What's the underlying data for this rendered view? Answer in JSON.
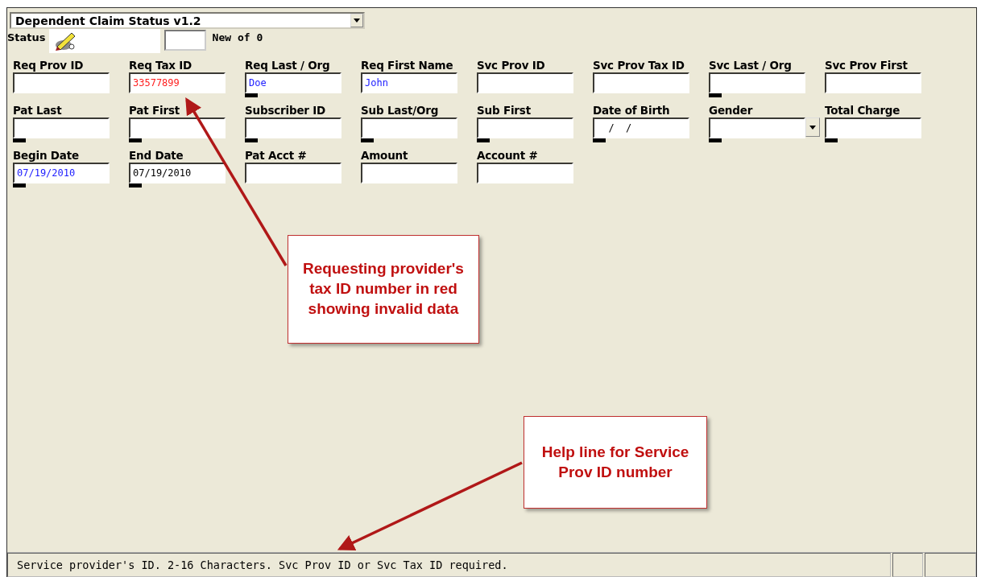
{
  "form_selector": {
    "value": "Dependent Claim Status v1.2"
  },
  "status": {
    "label": "Status",
    "new_label": "New",
    "of_label": "of 0"
  },
  "fields": [
    {
      "label": "Req Prov ID",
      "kind": "text",
      "marker": false
    },
    {
      "label": "Req Tax ID",
      "kind": "text",
      "value": "33577899",
      "color": "#ff2020",
      "marker": false
    },
    {
      "label": "Req Last / Org",
      "kind": "text",
      "value": "Doe",
      "color": "#2020ff",
      "marker": true
    },
    {
      "label": "Req First Name",
      "kind": "text",
      "value": "John",
      "color": "#2020ff",
      "marker": false
    },
    {
      "label": "Svc Prov ID",
      "kind": "text",
      "marker": false
    },
    {
      "label": "Svc Prov Tax ID",
      "kind": "text",
      "marker": false
    },
    {
      "label": "Svc Last / Org",
      "kind": "text",
      "marker": true
    },
    {
      "label": "Svc Prov First",
      "kind": "text",
      "marker": false
    },
    {
      "label": "Pat Last",
      "kind": "text",
      "marker": true
    },
    {
      "label": "Pat First",
      "kind": "text",
      "marker": true
    },
    {
      "label": "Subscriber ID",
      "kind": "text",
      "marker": true
    },
    {
      "label": "Sub Last/Org",
      "kind": "text",
      "marker": true
    },
    {
      "label": "Sub First",
      "kind": "text",
      "marker": true
    },
    {
      "label": "Date of Birth",
      "kind": "date",
      "value": "  /  /",
      "marker": true
    },
    {
      "label": "Gender",
      "kind": "dropdown",
      "marker": true
    },
    {
      "label": "Total Charge",
      "kind": "text",
      "marker": true
    },
    {
      "label": "Begin Date",
      "kind": "text",
      "value": "07/19/2010",
      "color": "#2020ff",
      "marker": true
    },
    {
      "label": "End Date",
      "kind": "text",
      "value": "07/19/2010",
      "color": "#000000",
      "marker": true
    },
    {
      "label": "Pat Acct #",
      "kind": "text",
      "marker": false
    },
    {
      "label": "Amount",
      "kind": "text",
      "marker": false
    },
    {
      "label": "Account #",
      "kind": "text",
      "marker": false
    }
  ],
  "callouts": [
    {
      "text": "Requesting provider's tax ID number in red showing invalid data"
    },
    {
      "text": "Help line for Service Prov ID number"
    }
  ],
  "status_bar": {
    "message": "Service provider's ID.  2-16 Characters.  Svc Prov ID or Svc Tax ID required."
  }
}
